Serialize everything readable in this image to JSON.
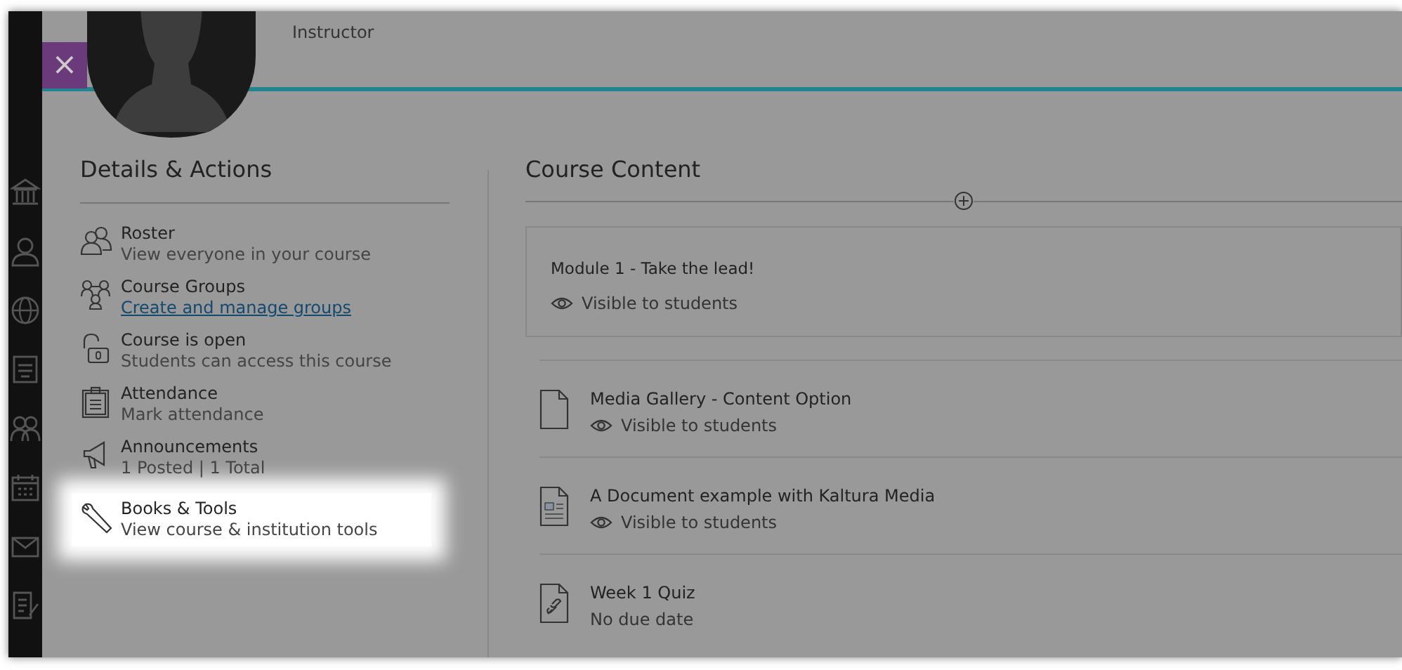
{
  "profile": {
    "role": "Instructor"
  },
  "close_button": {
    "label": "×"
  },
  "details": {
    "title": "Details & Actions",
    "items": [
      {
        "kind": "text",
        "title": "Roster",
        "subtitle": "View everyone in your course",
        "highlighted": false
      },
      {
        "kind": "link",
        "title": "Course Groups",
        "subtitle": "Create and manage groups",
        "highlighted": false
      },
      {
        "kind": "text",
        "title": "Course is open",
        "subtitle": "Students can access this course",
        "highlighted": false
      },
      {
        "kind": "text",
        "title": "Attendance",
        "subtitle": "Mark attendance",
        "highlighted": false
      },
      {
        "kind": "text",
        "title": "Announcements",
        "subtitle": "1 Posted | 1 Total",
        "highlighted": false
      },
      {
        "kind": "text",
        "title": "Books & Tools",
        "subtitle": "View course & institution tools",
        "highlighted": true
      }
    ]
  },
  "content": {
    "title": "Course Content",
    "module": {
      "title": "Module 1 - Take the lead!",
      "visibility": "Visible to students"
    },
    "items": [
      {
        "kind": "visible",
        "title": "Media Gallery - Content Option",
        "meta": "Visible to students"
      },
      {
        "kind": "visible",
        "title": "A Document example with Kaltura Media",
        "meta": "Visible to students"
      },
      {
        "kind": "due",
        "title": "Week 1 Quiz",
        "meta": "No due date"
      }
    ]
  }
}
